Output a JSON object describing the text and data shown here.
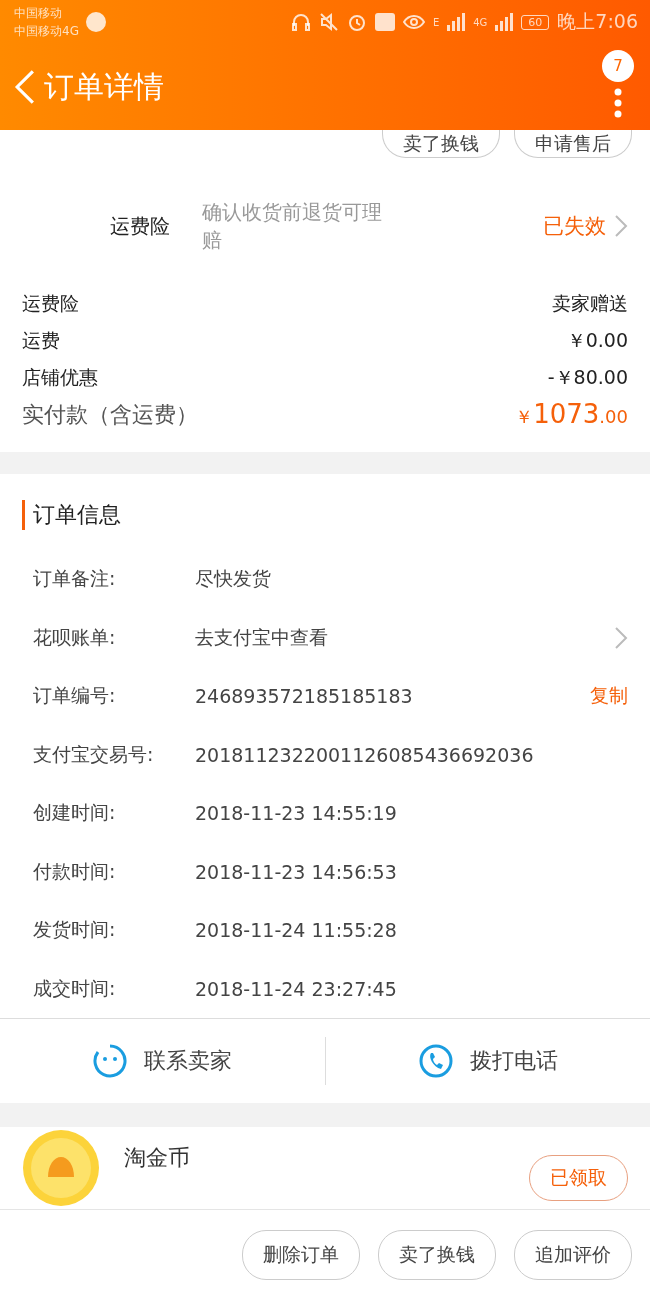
{
  "status_bar": {
    "carriers": [
      "中国移动",
      "中国移动4G"
    ],
    "network_1": "E",
    "network_2": "4G",
    "battery": "60",
    "time": "晚上7:06"
  },
  "header": {
    "title": "订单详情",
    "badge": "7"
  },
  "top_buttons": [
    "卖了换钱",
    "申请售后"
  ],
  "insurance": {
    "label": "运费险",
    "description": "确认收货前退货可理赔",
    "status": "已失效"
  },
  "fees": [
    {
      "label": "运费险",
      "value": "卖家赠送"
    },
    {
      "label": "运费",
      "value": "￥0.00"
    },
    {
      "label": "店铺优惠",
      "value": "-￥80.00"
    }
  ],
  "total": {
    "label": "实付款（含运费）",
    "currency": "￥",
    "integer": "1073",
    "decimal": ".00"
  },
  "order_info": {
    "title": "订单信息",
    "rows": [
      {
        "kind": "text",
        "label": "订单备注:",
        "value": "尽快发货"
      },
      {
        "kind": "link",
        "label": "花呗账单:",
        "value": "去支付宝中查看"
      },
      {
        "kind": "copy",
        "label": "订单编号:",
        "value": "246893572185185183",
        "action": "复制"
      },
      {
        "kind": "text",
        "label": "支付宝交易号:",
        "value": "2018112322001126085436692036"
      },
      {
        "kind": "text",
        "label": "创建时间:",
        "value": "2018-11-23 14:55:19"
      },
      {
        "kind": "text",
        "label": "付款时间:",
        "value": "2018-11-23 14:56:53"
      },
      {
        "kind": "text",
        "label": "发货时间:",
        "value": "2018-11-24 11:55:28"
      },
      {
        "kind": "text",
        "label": "成交时间:",
        "value": "2018-11-24 23:27:45"
      }
    ]
  },
  "contact": [
    {
      "kind": "chat",
      "label": "联系卖家"
    },
    {
      "kind": "phone",
      "label": "拨打电话"
    }
  ],
  "coins": {
    "title": "淘金币",
    "button": "已领取"
  },
  "bottom_buttons": [
    "删除订单",
    "卖了换钱",
    "追加评价"
  ]
}
